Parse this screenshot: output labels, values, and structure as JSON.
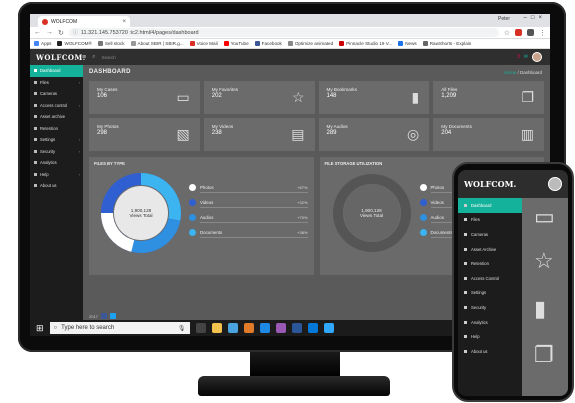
{
  "browser": {
    "tab_title": "WOLFCOM",
    "user": "Peter",
    "url": "11.321.145.753720 :ic2.html/4/pages/dashboard",
    "bookmarks": [
      "Apps",
      "WOLFCOM®",
      "Sell stock",
      "About SBIR | SBIR.g...",
      "Voice Mail",
      "YouTube",
      "Facebook",
      "Optimize animated",
      "Pinnacle Studio 19 V...",
      "News",
      "RawShorts - Explain"
    ]
  },
  "app": {
    "logo": "WOLFCOM.",
    "search_placeholder": "Search",
    "notification_count": "3",
    "page_title": "DASHBOARD",
    "breadcrumb_home": "Home",
    "breadcrumb_current": "Dashboard",
    "sidebar": [
      {
        "label": "Dashboard",
        "active": true
      },
      {
        "label": "Files",
        "chevron": true
      },
      {
        "label": "Cameras"
      },
      {
        "label": "Access control",
        "chevron": true
      },
      {
        "label": "Asset archive"
      },
      {
        "label": "Retention"
      },
      {
        "label": "Settings",
        "chevron": true
      },
      {
        "label": "Security",
        "chevron": true
      },
      {
        "label": "Analytics"
      },
      {
        "label": "Help",
        "chevron": true
      },
      {
        "label": "About us"
      }
    ],
    "cards": [
      {
        "label": "My Cases",
        "value": "106",
        "icon": "briefcase-icon",
        "glyph": "▭"
      },
      {
        "label": "My Favorites",
        "value": "202",
        "icon": "star-icon",
        "glyph": "☆"
      },
      {
        "label": "My Bookmarks",
        "value": "148",
        "icon": "bookmark-icon",
        "glyph": "▮"
      },
      {
        "label": "All Files",
        "value": "1,209",
        "icon": "files-icon",
        "glyph": "❐"
      },
      {
        "label": "My Photos",
        "value": "298",
        "icon": "photos-icon",
        "glyph": "▧"
      },
      {
        "label": "My Videos",
        "value": "238",
        "icon": "film-icon",
        "glyph": "▤"
      },
      {
        "label": "My Audios",
        "value": "289",
        "icon": "tape-icon",
        "glyph": "◎"
      },
      {
        "label": "My Documents",
        "value": "204",
        "icon": "document-icon",
        "glyph": "▥"
      }
    ],
    "files_panel": {
      "title": "FILES BY TYPE",
      "center_value": "1,900,128",
      "center_label": "Views Total",
      "items": [
        {
          "label": "Photos",
          "pct": "+87%",
          "color": "#ffffff"
        },
        {
          "label": "Videos",
          "pct": "+32%",
          "color": "#2f5fd0"
        },
        {
          "label": "Audios",
          "pct": "+70%",
          "color": "#2f8fe0"
        },
        {
          "label": "Documents",
          "pct": "+38%",
          "color": "#3bb4f0"
        }
      ]
    },
    "storage_panel": {
      "title": "FILE STORAGE UTILIZATION",
      "center_value": "1,900,128",
      "center_label": "Views Total",
      "items": [
        {
          "label": "Photos",
          "pct": "",
          "color": "#ffffff"
        },
        {
          "label": "Videos",
          "pct": "",
          "color": "#2f5fd0"
        },
        {
          "label": "Audios",
          "pct": "",
          "color": "#2f8fe0"
        },
        {
          "label": "Documents",
          "pct": "",
          "color": "#3bb4f0"
        }
      ]
    },
    "footer_text": "2017"
  },
  "taskbar": {
    "search_placeholder": "Type here to search"
  },
  "phone": {
    "logo": "WOLFCOM.",
    "sidebar": [
      "Dashboard",
      "Files",
      "Cameras",
      "Asset Archive",
      "Retention",
      "Access Control",
      "Settings",
      "Security",
      "Analytics",
      "Help",
      "About us"
    ]
  },
  "colors": {
    "accent": "#14b29a",
    "panel": "#6b6b6b",
    "sidebar": "#1c1c1c"
  }
}
